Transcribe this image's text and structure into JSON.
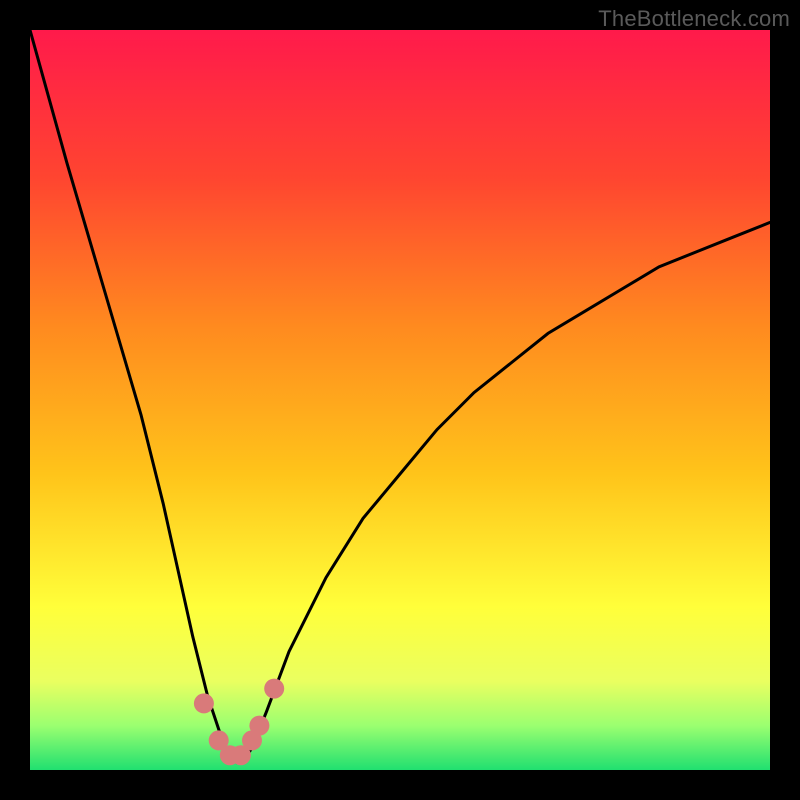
{
  "watermark": "TheBottleneck.com",
  "gradient": {
    "stops": [
      {
        "offset": 0.0,
        "color": "#ff1a4b"
      },
      {
        "offset": 0.2,
        "color": "#ff4530"
      },
      {
        "offset": 0.4,
        "color": "#ff8a1f"
      },
      {
        "offset": 0.6,
        "color": "#ffc41a"
      },
      {
        "offset": 0.78,
        "color": "#ffff3a"
      },
      {
        "offset": 0.88,
        "color": "#eaff60"
      },
      {
        "offset": 0.94,
        "color": "#9bff70"
      },
      {
        "offset": 1.0,
        "color": "#20e070"
      }
    ]
  },
  "chart_data": {
    "type": "line",
    "title": "",
    "xlabel": "",
    "ylabel": "",
    "xlim": [
      0,
      100
    ],
    "ylim": [
      0,
      100
    ],
    "series": [
      {
        "name": "bottleneck-curve",
        "x": [
          0,
          5,
          10,
          15,
          18,
          20,
          22,
          24,
          26,
          27,
          28,
          29,
          30,
          32,
          35,
          40,
          45,
          50,
          55,
          60,
          65,
          70,
          75,
          80,
          85,
          90,
          95,
          100
        ],
        "values": [
          100,
          82,
          65,
          48,
          36,
          27,
          18,
          10,
          4,
          2,
          1,
          1.5,
          3,
          8,
          16,
          26,
          34,
          40,
          46,
          51,
          55,
          59,
          62,
          65,
          68,
          70,
          72,
          74
        ]
      }
    ],
    "markers": [
      {
        "x": 23.5,
        "y": 9,
        "r": 10,
        "color": "#d97a7a"
      },
      {
        "x": 25.5,
        "y": 4,
        "r": 10,
        "color": "#d97a7a"
      },
      {
        "x": 27.0,
        "y": 2,
        "r": 10,
        "color": "#d97a7a"
      },
      {
        "x": 28.5,
        "y": 2,
        "r": 10,
        "color": "#d97a7a"
      },
      {
        "x": 30.0,
        "y": 4,
        "r": 10,
        "color": "#d97a7a"
      },
      {
        "x": 31.0,
        "y": 6,
        "r": 10,
        "color": "#d97a7a"
      },
      {
        "x": 33.0,
        "y": 11,
        "r": 10,
        "color": "#d97a7a"
      }
    ]
  }
}
